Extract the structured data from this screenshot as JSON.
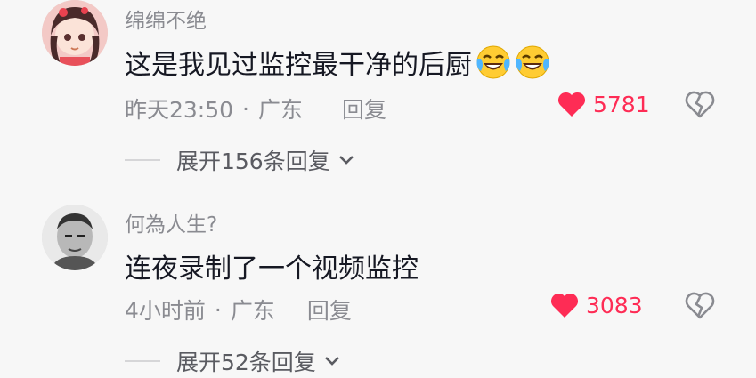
{
  "comments": [
    {
      "username": "绵绵不绝",
      "text": "这是我见过监控最干净的后厨",
      "emojis": [
        "laughing-crying-emoji",
        "laughing-crying-emoji"
      ],
      "time": "昨天23:50",
      "location": "广东",
      "reply_label": "回复",
      "likes": "5781",
      "expand_label": "展开156条回复"
    },
    {
      "username": "何為人生?",
      "text": "连夜录制了一个视频监控",
      "emojis": [],
      "time": "4小时前",
      "location": "广东",
      "reply_label": "回复",
      "likes": "3083",
      "expand_label": "展开52条回复"
    }
  ],
  "separator": "·",
  "colors": {
    "like": "#fe2c55",
    "meta": "#8a8b91",
    "text": "#161823",
    "background": "#f7f7f7"
  },
  "icons": {
    "like": "heart-icon",
    "dislike": "broken-heart-icon",
    "expand": "chevron-down-icon"
  }
}
